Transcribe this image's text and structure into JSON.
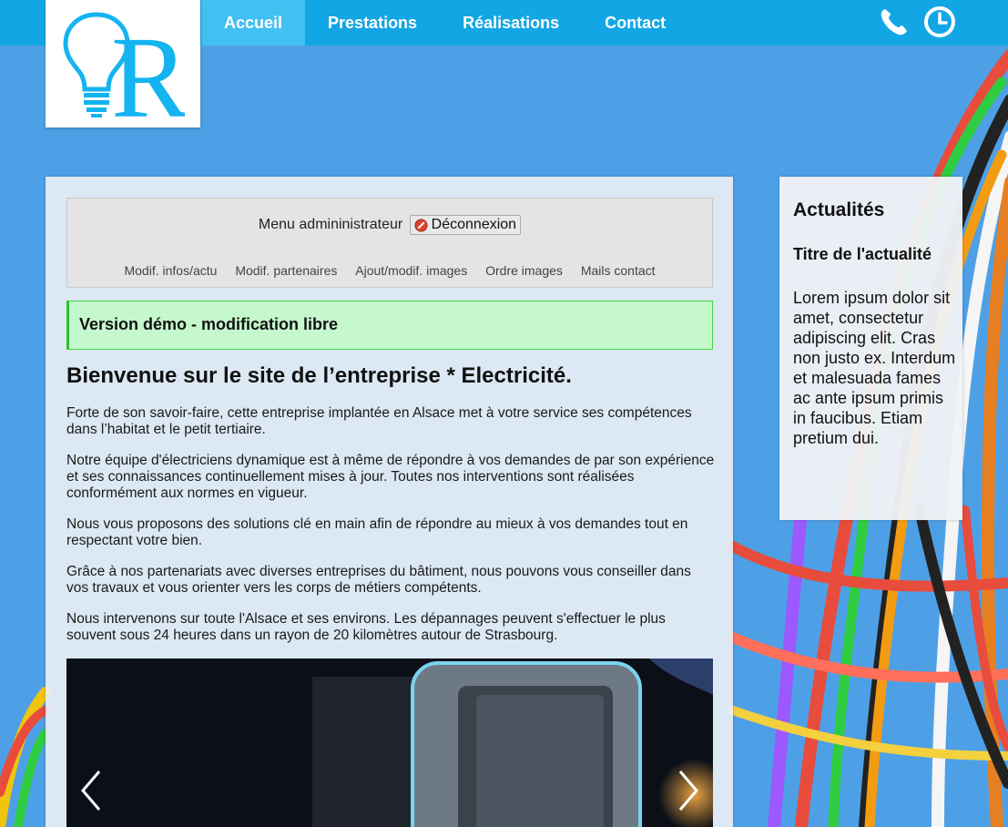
{
  "colors": {
    "navbar": "#13a6e4",
    "nav_active": "#41c0f2",
    "background": "#4ea0e6",
    "alert_bg": "#c5f8cd",
    "alert_border": "#3ed63e",
    "logo": "#14b4f0"
  },
  "logo": {
    "letter": "R",
    "icon": "lightbulb-icon"
  },
  "nav": {
    "items": [
      {
        "label": "Accueil",
        "active": true
      },
      {
        "label": "Prestations",
        "active": false
      },
      {
        "label": "Réalisations",
        "active": false
      },
      {
        "label": "Contact",
        "active": false
      }
    ],
    "icons": [
      "phone-icon",
      "clock-icon"
    ]
  },
  "admin": {
    "menu_label": "Menu admininistrateur",
    "logout_label": "Déconnexion",
    "links": [
      "Modif. infos/actu",
      "Modif. partenaires",
      "Ajout/modif. images",
      "Ordre images",
      "Mails contact"
    ]
  },
  "alert": "Version démo - modification libre",
  "main": {
    "title": "Bienvenue sur le site de l’entreprise * Electricité.",
    "paragraphs": [
      "Forte de son savoir-faire, cette entreprise implantée en Alsace met à votre service ses compétences dans l’habitat et le petit tertiaire.",
      "Notre équipe d'électriciens dynamique est à même de répondre à vos demandes de par son expérience et ses connaissances continuellement mises à jour. Toutes nos interventions sont réalisées conformément aux normes en vigueur.",
      "Nous vous proposons des solutions clé en main afin de répondre au mieux à vos demandes tout en respectant votre bien.",
      "Grâce à nos partenariats avec diverses entreprises du bâtiment, nous pouvons vous conseiller dans vos travaux et vous orienter vers les corps de métiers compétents.",
      "Nous intervenons sur toute l'Alsace et ses environs. Les dépannages peuvent s'effectuer le plus souvent sous 24 heures dans un rayon de 20 kilomètres autour de Strasbourg."
    ]
  },
  "carousel": {
    "prev_icon": "chevron-left-icon",
    "next_icon": "chevron-right-icon"
  },
  "sidebar": {
    "title": "Actualités",
    "news_title": "Titre de l'actualité",
    "news_body": "Lorem ipsum dolor sit amet, consectetur adipiscing elit. Cras non justo ex. Interdum et malesuada fames ac ante ipsum primis in faucibus. Etiam pretium dui."
  }
}
